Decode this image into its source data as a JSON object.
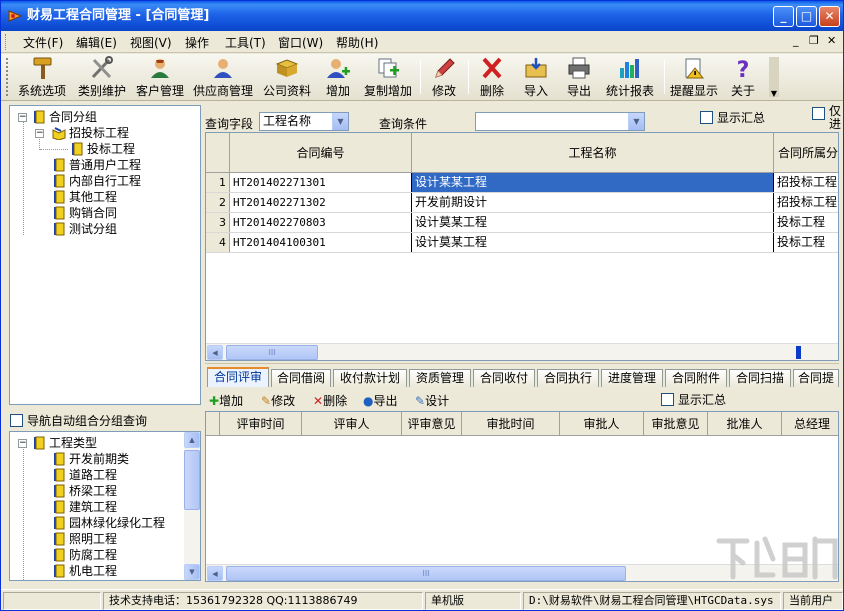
{
  "window": {
    "title": "财易工程合同管理 - [合同管理]"
  },
  "menu": {
    "items": [
      "文件(F)",
      "编辑(E)",
      "视图(V)",
      "操作",
      "工具(T)",
      "窗口(W)",
      "帮助(H)"
    ]
  },
  "toolbar": {
    "buttons": [
      "系统选项",
      "类别维护",
      "客户管理",
      "供应商管理",
      "公司资料",
      "增加",
      "复制增加",
      "修改",
      "删除",
      "导入",
      "导出",
      "统计报表",
      "提醒显示",
      "关于"
    ]
  },
  "tree1": {
    "nodes": [
      "合同分组",
      "招投标工程",
      "投标工程",
      "普通用户工程",
      "内部自行工程",
      "其他工程",
      "购销合同",
      "测试分组"
    ]
  },
  "nav_check": {
    "label": "导航自动组合分组查询"
  },
  "tree2": {
    "nodes": [
      "工程类型",
      "开发前期类",
      "道路工程",
      "桥梁工程",
      "建筑工程",
      "园林绿化绿化工程",
      "照明工程",
      "防腐工程",
      "机电工程"
    ]
  },
  "query": {
    "field_label": "查询字段",
    "field_value": "工程名称",
    "condition_label": "查询条件",
    "condition_value": "",
    "show_summary": "显示汇总",
    "cut_text": "仅\n进"
  },
  "grid": {
    "headers": [
      "合同编号",
      "工程名称",
      "合同所属分"
    ],
    "rows": [
      {
        "no": "1",
        "code": "HT201402271301",
        "name": "设计某某工程",
        "group": "招投标工程"
      },
      {
        "no": "2",
        "code": "HT201402271302",
        "name": "开发前期设计",
        "group": "招投标工程"
      },
      {
        "no": "3",
        "code": "HT201402270803",
        "name": "设计莫某工程",
        "group": "投标工程"
      },
      {
        "no": "4",
        "code": "HT201404100301",
        "name": "设计莫某工程",
        "group": "投标工程"
      }
    ]
  },
  "tabs": [
    "合同评审",
    "合同借阅",
    "收付款计划",
    "资质管理",
    "合同收付",
    "合同执行",
    "进度管理",
    "合同附件",
    "合同扫描",
    "合同提"
  ],
  "subbar": {
    "add": "增加",
    "edit": "修改",
    "delete": "删除",
    "export": "导出",
    "design": "设计",
    "show_summary": "显示汇总"
  },
  "sub_grid": {
    "headers": [
      "评审时间",
      "评审人",
      "评审意见",
      "审批时间",
      "审批人",
      "审批意见",
      "批准人",
      "总经理"
    ]
  },
  "status": {
    "support": "技术支持电话：15361792328 QQ:1113886749",
    "mode": "单机版",
    "path": "D:\\财易软件\\财易工程合同管理\\HTGCData.sys",
    "user": "当前用户"
  },
  "colors": {
    "title_bar": "#0a5be8",
    "selection": "#316ac5",
    "tab_accent": "#e68b2c",
    "window_bg": "#ece9d8"
  }
}
